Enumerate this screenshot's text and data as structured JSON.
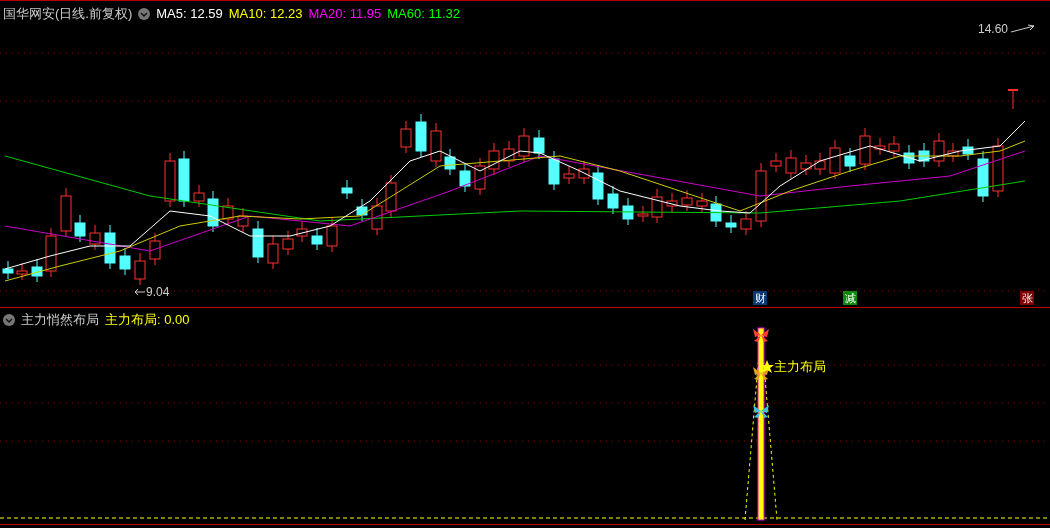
{
  "title": "国华网安(日线.前复权)",
  "moving_averages": [
    {
      "label": "MA5: 12.59",
      "color": "#ffffff"
    },
    {
      "label": "MA10: 12.23",
      "color": "#ffff00"
    },
    {
      "label": "MA20: 11.95",
      "color": "#ff00ff"
    },
    {
      "label": "MA60: 11.32",
      "color": "#00ff00"
    }
  ],
  "price_high": "14.60",
  "price_low": "9.04",
  "markers": [
    {
      "text": "财",
      "color": "#0b3a72"
    },
    {
      "text": "减",
      "color": "#0a8a0a"
    },
    {
      "text": "张",
      "color": "#800000"
    }
  ],
  "indicator": {
    "name": "主力悄然布局",
    "value": "主力布局: 0.00",
    "signal_label": "主力布局"
  }
}
